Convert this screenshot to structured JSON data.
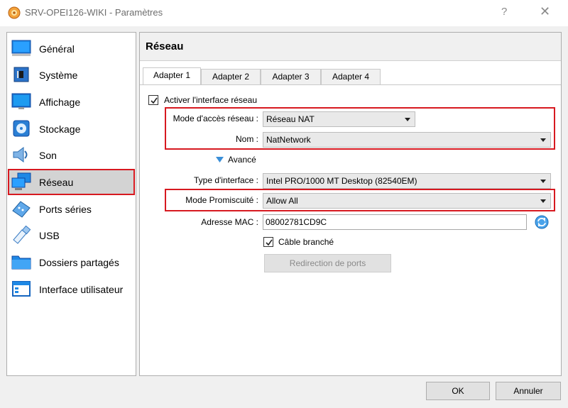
{
  "window": {
    "title": "SRV-OPEI126-WIKI - Paramètres",
    "help": "?",
    "close": "✕"
  },
  "sidebar": {
    "items": [
      {
        "label": "Général",
        "icon": "general-icon"
      },
      {
        "label": "Système",
        "icon": "system-icon"
      },
      {
        "label": "Affichage",
        "icon": "display-icon"
      },
      {
        "label": "Stockage",
        "icon": "storage-icon"
      },
      {
        "label": "Son",
        "icon": "audio-icon"
      },
      {
        "label": "Réseau",
        "icon": "network-icon",
        "selected": true
      },
      {
        "label": "Ports séries",
        "icon": "serial-ports-icon"
      },
      {
        "label": "USB",
        "icon": "usb-icon"
      },
      {
        "label": "Dossiers partagés",
        "icon": "shared-folders-icon"
      },
      {
        "label": "Interface utilisateur",
        "icon": "user-interface-icon"
      }
    ]
  },
  "panel": {
    "title": "Réseau",
    "tabs": [
      "Adapter 1",
      "Adapter 2",
      "Adapter 3",
      "Adapter 4"
    ],
    "active_tab": "Adapter 1"
  },
  "adapter": {
    "enable_label": "Activer l'interface réseau",
    "enable_checked": true,
    "access_mode_label": "Mode d'accès réseau :",
    "access_mode_value": "Réseau NAT",
    "name_label": "Nom :",
    "name_value": "NatNetwork",
    "advanced_label": "Avancé",
    "iface_type_label": "Type d'interface :",
    "iface_type_value": "Intel PRO/1000 MT Desktop (82540EM)",
    "promisc_label": "Mode Promiscuité :",
    "promisc_value": "Allow All",
    "mac_label": "Adresse MAC :",
    "mac_value": "08002781CD9C",
    "cable_label": "Câble branché",
    "cable_checked": true,
    "port_forwarding_label": "Redirection de ports"
  },
  "footer": {
    "ok_label": "OK",
    "cancel_label": "Annuler"
  },
  "colors": {
    "highlight": "#d71920",
    "selected_bg": "#d3d3d3"
  }
}
